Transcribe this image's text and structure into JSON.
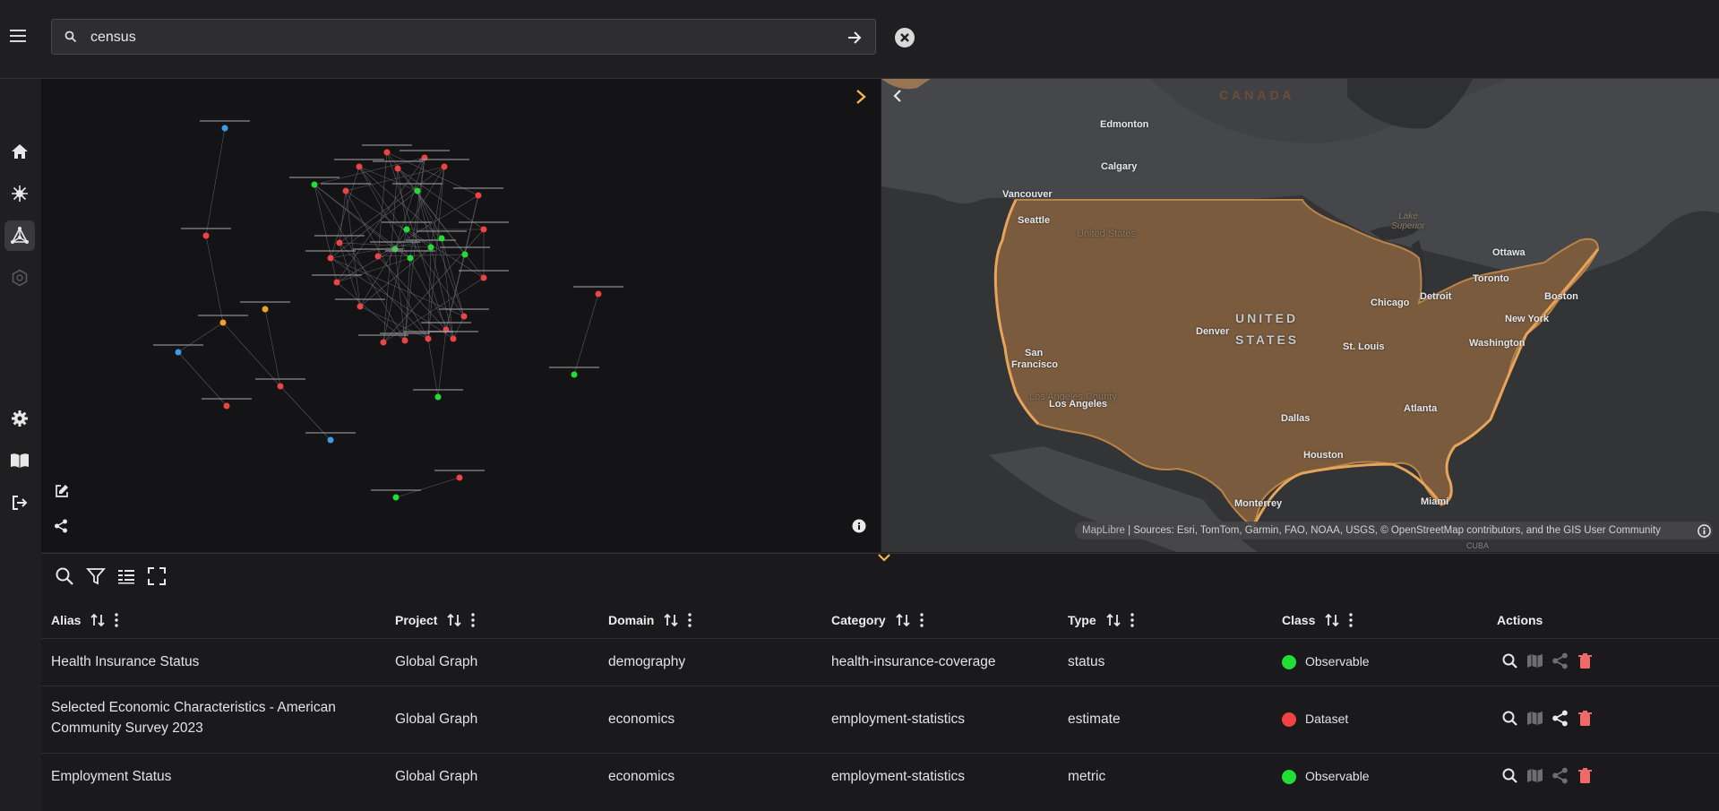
{
  "search": {
    "value": "census"
  },
  "map": {
    "labels": {
      "canada": "CANADA",
      "edmonton": "Edmonton",
      "calgary": "Calgary",
      "vancouver": "Vancouver",
      "seattle": "Seattle",
      "united_states_small": "United States",
      "lake_superior": "Lake Superior",
      "ottawa": "Ottawa",
      "toronto": "Toronto",
      "detroit": "Detroit",
      "chicago": "Chicago",
      "boston": "Boston",
      "new_york": "New York",
      "united": "UNITED",
      "states": "STATES",
      "denver": "Denver",
      "st_louis": "St. Louis",
      "washington": "Washington",
      "san": "San",
      "francisco": "Francisco",
      "la_county": "Los Angeles County",
      "los_angeles": "Los Angeles",
      "dallas": "Dallas",
      "atlanta": "Atlanta",
      "houston": "Houston",
      "monterrey": "Monterrey",
      "miami": "Miami",
      "cuba": "CUBA"
    },
    "attribution_brand": "MapLibre",
    "attribution": "| Sources: Esri, TomTom, Garmin, FAO, NOAA, USGS, © OpenStreetMap contributors, and the GIS User Community"
  },
  "table": {
    "headers": {
      "alias": "Alias",
      "project": "Project",
      "domain": "Domain",
      "category": "Category",
      "type": "Type",
      "class": "Class",
      "actions": "Actions"
    },
    "rows": [
      {
        "alias": "Health Insurance Status",
        "project": "Global Graph",
        "domain": "demography",
        "category": "health-insurance-coverage",
        "type": "status",
        "class": "Observable",
        "class_color": "#22dd33"
      },
      {
        "alias": "Selected Economic Characteristics - American Community Survey 2023",
        "project": "Global Graph",
        "domain": "economics",
        "category": "employment-statistics",
        "type": "estimate",
        "class": "Dataset",
        "class_color": "#ef4343"
      },
      {
        "alias": "Employment Status",
        "project": "Global Graph",
        "domain": "economics",
        "category": "employment-statistics",
        "type": "metric",
        "class": "Observable",
        "class_color": "#22dd33"
      }
    ]
  },
  "colors": {
    "accent": "#f5a623",
    "observable": "#22dd33",
    "dataset": "#ef4343",
    "entity": "#3b9ce8",
    "place": "#f0a030"
  }
}
